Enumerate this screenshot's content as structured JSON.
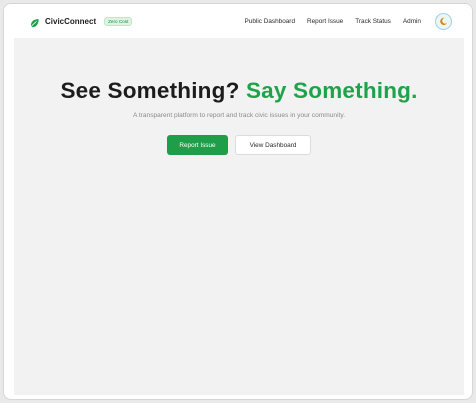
{
  "brand": {
    "name": "CivicConnect",
    "badge": "Zero Cost",
    "logo_icon": "leaf-icon",
    "accent_color": "#1ea24a"
  },
  "nav": {
    "links": [
      "Public Dashboard",
      "Report Issue",
      "Track Status",
      "Admin"
    ],
    "theme_toggle_icon": "moon-icon"
  },
  "hero": {
    "headline_part1": "See Something?",
    "headline_part2": "Say Something.",
    "subtitle": "A transparent platform to report and track civic issues in your community.",
    "primary_button": "Report Issue",
    "secondary_button": "View Dashboard"
  }
}
